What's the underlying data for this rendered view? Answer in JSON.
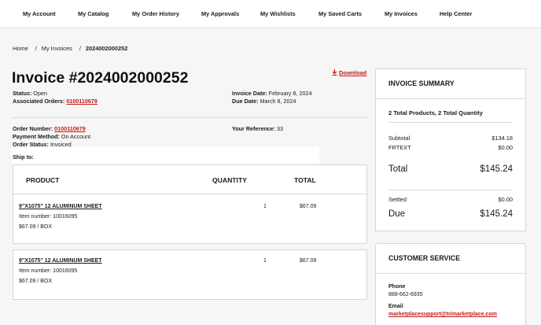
{
  "nav": [
    "My Account",
    "My Catalog",
    "My Order History",
    "My Approvals",
    "My Wishlists",
    "My Saved Carts",
    "My Invoices",
    "Help Center"
  ],
  "breadcrumb": {
    "home": "Home",
    "invoices": "My Invoices",
    "current": "2024002000252"
  },
  "invoice": {
    "title": "Invoice #2024002000252",
    "download": "Download",
    "status_label": "Status:",
    "status": "Open",
    "assoc_label": "Associated Orders:",
    "assoc": "0100110679",
    "date_label": "Invoice Date:",
    "date": "February 8, 2024",
    "due_label": "Due Date:",
    "due": "March 8, 2024",
    "order_label": "Order Number:",
    "order": "0100110679",
    "payment_label": "Payment Method:",
    "payment": "On Account",
    "ostatus_label": "Order Status:",
    "ostatus": "Invoiced",
    "shipto_label": "Ship to:",
    "ref_label": "Your Reference:",
    "ref": "33"
  },
  "table": {
    "headers": {
      "product": "PRODUCT",
      "quantity": "QUANTITY",
      "total": "TOTAL"
    },
    "items": [
      {
        "name": "9\"X1075\" 12 ALUMINUM SHEET",
        "item_number": "Item number: 10016095",
        "price": "$67.09 / BOX",
        "qty": "1",
        "total": "$67.09"
      },
      {
        "name": "9\"X1075\" 12 ALUMINUM SHEET",
        "item_number": "Item number: 10016095",
        "price": "$67.09 / BOX",
        "qty": "1",
        "total": "$67.09"
      }
    ]
  },
  "summary": {
    "title": "INVOICE SUMMARY",
    "counts": "2 Total Products, 2 Total Quantity",
    "subtotal_label": "Subtotal",
    "subtotal": "$134.18",
    "frtext_label": "FRTEXT",
    "frtext": "$0.00",
    "total_label": "Total",
    "total": "$145.24",
    "settled_label": "Settled",
    "settled": "$0.00",
    "due_label": "Due",
    "due": "$145.24"
  },
  "service": {
    "title": "CUSTOMER SERVICE",
    "phone_label": "Phone",
    "phone": "888-662-6935",
    "email_label": "Email",
    "email": "marketplacesupport@trimarketplace.com"
  }
}
